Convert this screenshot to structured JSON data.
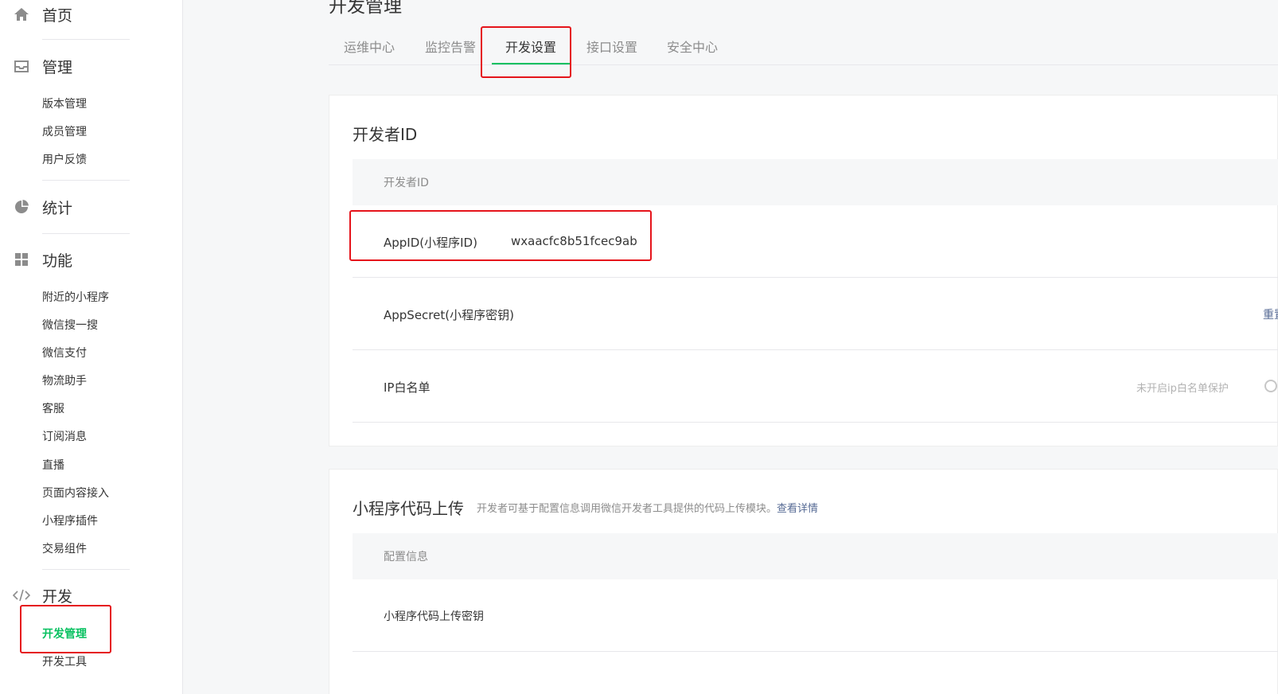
{
  "sidebar": {
    "home": "首页",
    "manage": {
      "label": "管理",
      "items": [
        "版本管理",
        "成员管理",
        "用户反馈"
      ]
    },
    "stats": {
      "label": "统计"
    },
    "features": {
      "label": "功能",
      "items": [
        "附近的小程序",
        "微信搜一搜",
        "微信支付",
        "物流助手",
        "客服",
        "订阅消息",
        "直播",
        "页面内容接入",
        "小程序插件",
        "交易组件"
      ]
    },
    "develop": {
      "label": "开发",
      "items": [
        "开发管理",
        "开发工具"
      ],
      "active_item": "开发管理"
    }
  },
  "page": {
    "title": "开发管理"
  },
  "tabs": [
    "运维中心",
    "监控告警",
    "开发设置",
    "接口设置",
    "安全中心"
  ],
  "active_tab": "开发设置",
  "developer_id_card": {
    "title": "开发者ID",
    "table_header": "开发者ID",
    "rows": [
      {
        "key": "AppID(小程序ID)",
        "value": "wxaacfc8b51fcec9ab"
      },
      {
        "key": "AppSecret(小程序密钥)",
        "action": "重置"
      },
      {
        "key": "IP白名单",
        "hint": "未开启ip白名单保护"
      }
    ]
  },
  "upload_card": {
    "title": "小程序代码上传",
    "desc": "开发者可基于配置信息调用微信开发者工具提供的代码上传模块。",
    "desc_link": "查看详情",
    "table_header": "配置信息",
    "rows": [
      {
        "key": "小程序代码上传密钥"
      }
    ]
  },
  "colors": {
    "accent": "#07c160",
    "link": "#576b95",
    "highlight": "#e5141b"
  },
  "icons": [
    "home-icon",
    "inbox-icon",
    "pie-chart-icon",
    "grid-icon",
    "code-icon"
  ]
}
